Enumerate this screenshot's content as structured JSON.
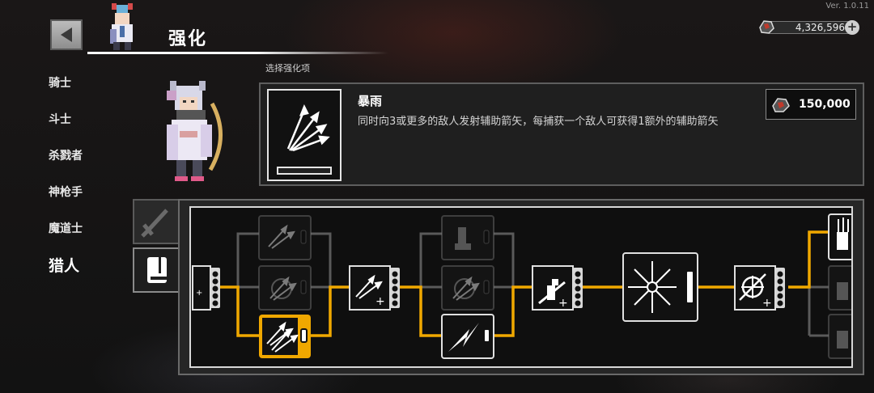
{
  "version": "Ver. 1.0.11",
  "header": {
    "title": "强化"
  },
  "currency": {
    "amount": "4,326,596"
  },
  "classes": [
    {
      "label": "骑士",
      "active": false
    },
    {
      "label": "斗士",
      "active": false
    },
    {
      "label": "杀戮者",
      "active": false
    },
    {
      "label": "神枪手",
      "active": false
    },
    {
      "label": "魔道士",
      "active": false
    },
    {
      "label": "猎人",
      "active": true
    }
  ],
  "section_label": "选择强化项",
  "skill": {
    "name": "暴雨",
    "description": "同时向3或更多的敌人发射辅助箭矢，每捕获一个敌人可获得1额外的辅助箭矢",
    "cost": "150,000"
  },
  "tabs": [
    {
      "icon": "sword-icon",
      "active": false
    },
    {
      "icon": "book-icon",
      "active": true
    }
  ],
  "skill_tree": {
    "nodes": [
      {
        "id": "n0",
        "icon": "arrow-plus-icon",
        "state": "unlocked"
      },
      {
        "id": "n1a",
        "icon": "bow-shot-icon",
        "state": "locked"
      },
      {
        "id": "n1b",
        "icon": "crossbow-icon",
        "state": "locked"
      },
      {
        "id": "n1c",
        "icon": "arrow-rain-icon",
        "state": "selected"
      },
      {
        "id": "n2",
        "icon": "double-arrow-plus-icon",
        "state": "unlocked"
      },
      {
        "id": "n3a",
        "icon": "boot-icon",
        "state": "locked"
      },
      {
        "id": "n3b",
        "icon": "crossbow-icon",
        "state": "locked"
      },
      {
        "id": "n3c",
        "icon": "lightning-arrow-icon",
        "state": "unlocked"
      },
      {
        "id": "n4",
        "icon": "archer-plus-icon",
        "state": "unlocked"
      },
      {
        "id": "n5",
        "icon": "arrow-burst-icon",
        "state": "unlocked"
      },
      {
        "id": "n6",
        "icon": "crosshair-plus-icon",
        "state": "unlocked"
      },
      {
        "id": "n7a",
        "icon": "quiver-icon",
        "state": "unlocked"
      },
      {
        "id": "n7b",
        "icon": "quiver-icon",
        "state": "locked"
      },
      {
        "id": "n7c",
        "icon": "quiver-icon",
        "state": "locked"
      }
    ]
  },
  "colors": {
    "path_active": "#f0a800",
    "path_locked": "#5a5a5a",
    "node_selected": "#f0a800"
  }
}
